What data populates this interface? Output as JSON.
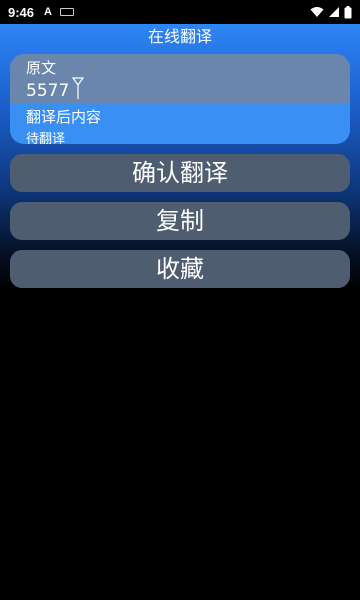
{
  "status_bar": {
    "time": "9:46",
    "icons": [
      "android-a-icon",
      "keyboard-icon",
      "wifi-icon",
      "signal-icon",
      "battery-icon"
    ]
  },
  "app": {
    "title": "在线翻译"
  },
  "form": {
    "original_label": "原文",
    "original_value": "5577",
    "translated_label": "翻译后内容",
    "translated_value": "待翻译"
  },
  "buttons": {
    "translate": "确认翻译",
    "copy": "复制",
    "favorite": "收藏"
  },
  "colors": {
    "header_blue": "#2f86f5",
    "card_top": "#6a86ad",
    "card_bottom": "#3a8ff5",
    "button_bg": "#4f5d70"
  }
}
